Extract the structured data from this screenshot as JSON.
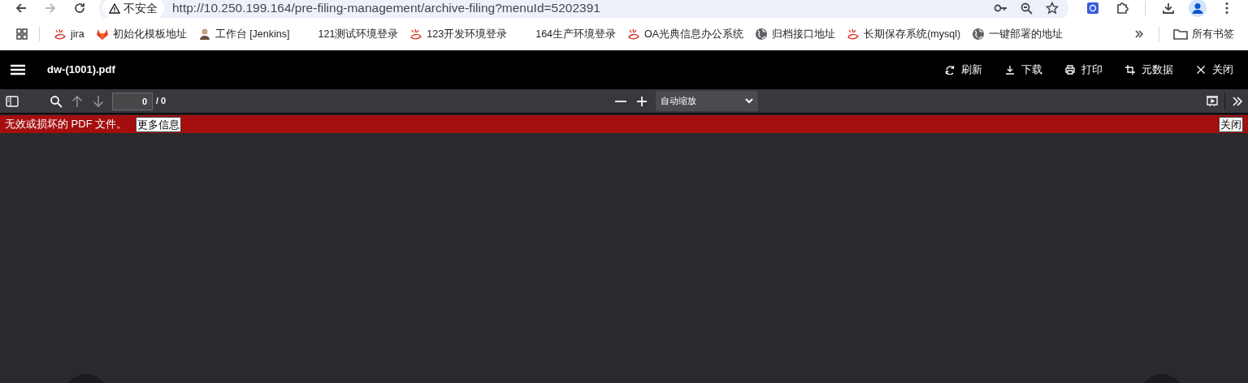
{
  "browser": {
    "back_enabled": true,
    "forward_enabled": false,
    "security_label": "不安全",
    "url": "http://10.250.199.164/pre-filing-management/archive-filing?menuId=5202391",
    "bookmarks": [
      {
        "label": "jira",
        "kind": "swirl"
      },
      {
        "label": "初始化模板地址",
        "kind": "fox"
      },
      {
        "label": "工作台 [Jenkins]",
        "kind": "figure"
      },
      {
        "label": "121测试环境登录",
        "kind": "blank"
      },
      {
        "label": "123开发环境登录",
        "kind": "swirl"
      },
      {
        "label": "164生产环境登录",
        "kind": "blank"
      },
      {
        "label": "OA光典信息办公系统",
        "kind": "swirl"
      },
      {
        "label": "归档接口地址",
        "kind": "globe"
      },
      {
        "label": "长期保存系统(mysql)",
        "kind": "swirl"
      },
      {
        "label": "一键部署的地址",
        "kind": "globe"
      }
    ],
    "all_bookmarks": "所有书签"
  },
  "header": {
    "title": "dw-(1001).pdf",
    "actions": [
      {
        "label": "刷新",
        "kind": "refresh"
      },
      {
        "label": "下载",
        "kind": "download"
      },
      {
        "label": "打印",
        "kind": "print"
      },
      {
        "label": "元数据",
        "kind": "crop"
      },
      {
        "label": "关闭",
        "kind": "close"
      }
    ]
  },
  "toolbar": {
    "prev_enabled": false,
    "next_enabled": false,
    "page": "0",
    "page_count": "/ 0",
    "zoom": "自动缩放"
  },
  "error_bar": {
    "message": "无效或损坏的 PDF 文件。",
    "more_info": "更多信息",
    "close": "关闭"
  }
}
